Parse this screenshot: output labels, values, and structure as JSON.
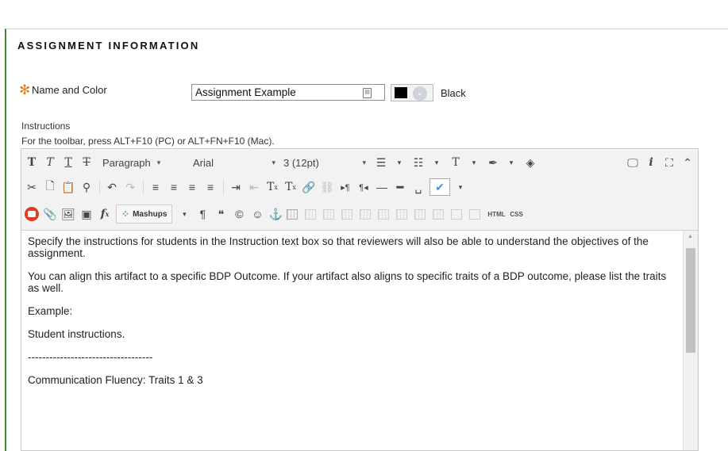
{
  "section": {
    "title": "ASSIGNMENT INFORMATION"
  },
  "name_field": {
    "required_marker": "✻",
    "label": "Name and Color",
    "value": "Assignment Example"
  },
  "color": {
    "value": "#000000",
    "label": "Black"
  },
  "instructions": {
    "label": "Instructions",
    "toolbar_hint": "For the toolbar, press ALT+F10 (PC) or ALT+FN+F10 (Mac)."
  },
  "toolbar": {
    "row1": {
      "bold": "T",
      "italic": "T",
      "underline": "T",
      "strike": "T",
      "format": "Paragraph",
      "font": "Arial",
      "size": "3 (12pt)",
      "text_color": "T",
      "caret": "▾",
      "dd_arrow": "▾"
    },
    "row2": {
      "superscript": "T",
      "superscript_mark": "x",
      "subscript": "T",
      "subscript_mark": "x"
    },
    "row3": {
      "insert_math": "f",
      "mashups": "Mashups",
      "pilcrow": "¶",
      "quote": "❝",
      "copyright": "©",
      "emoticon": "☺",
      "anchor": "⚓",
      "html": "HTML",
      "css": "CSS"
    }
  },
  "content": {
    "paragraphs": [
      "Specify the instructions for students in the Instruction text box so that reviewers will also be able to understand the objectives of the assignment.",
      "You can align this artifact to a specific BDP Outcome. If your artifact also aligns to specific traits of a BDP outcome, please list the traits as well.",
      "Example:",
      "Student instructions.",
      "-----------------------------------",
      "Communication Fluency: Traits 1 & 3"
    ]
  },
  "colors": {
    "accent_green": "#3e8b2e",
    "required_orange": "#e37a15",
    "toolbar_bg": "#f2f2f2"
  }
}
